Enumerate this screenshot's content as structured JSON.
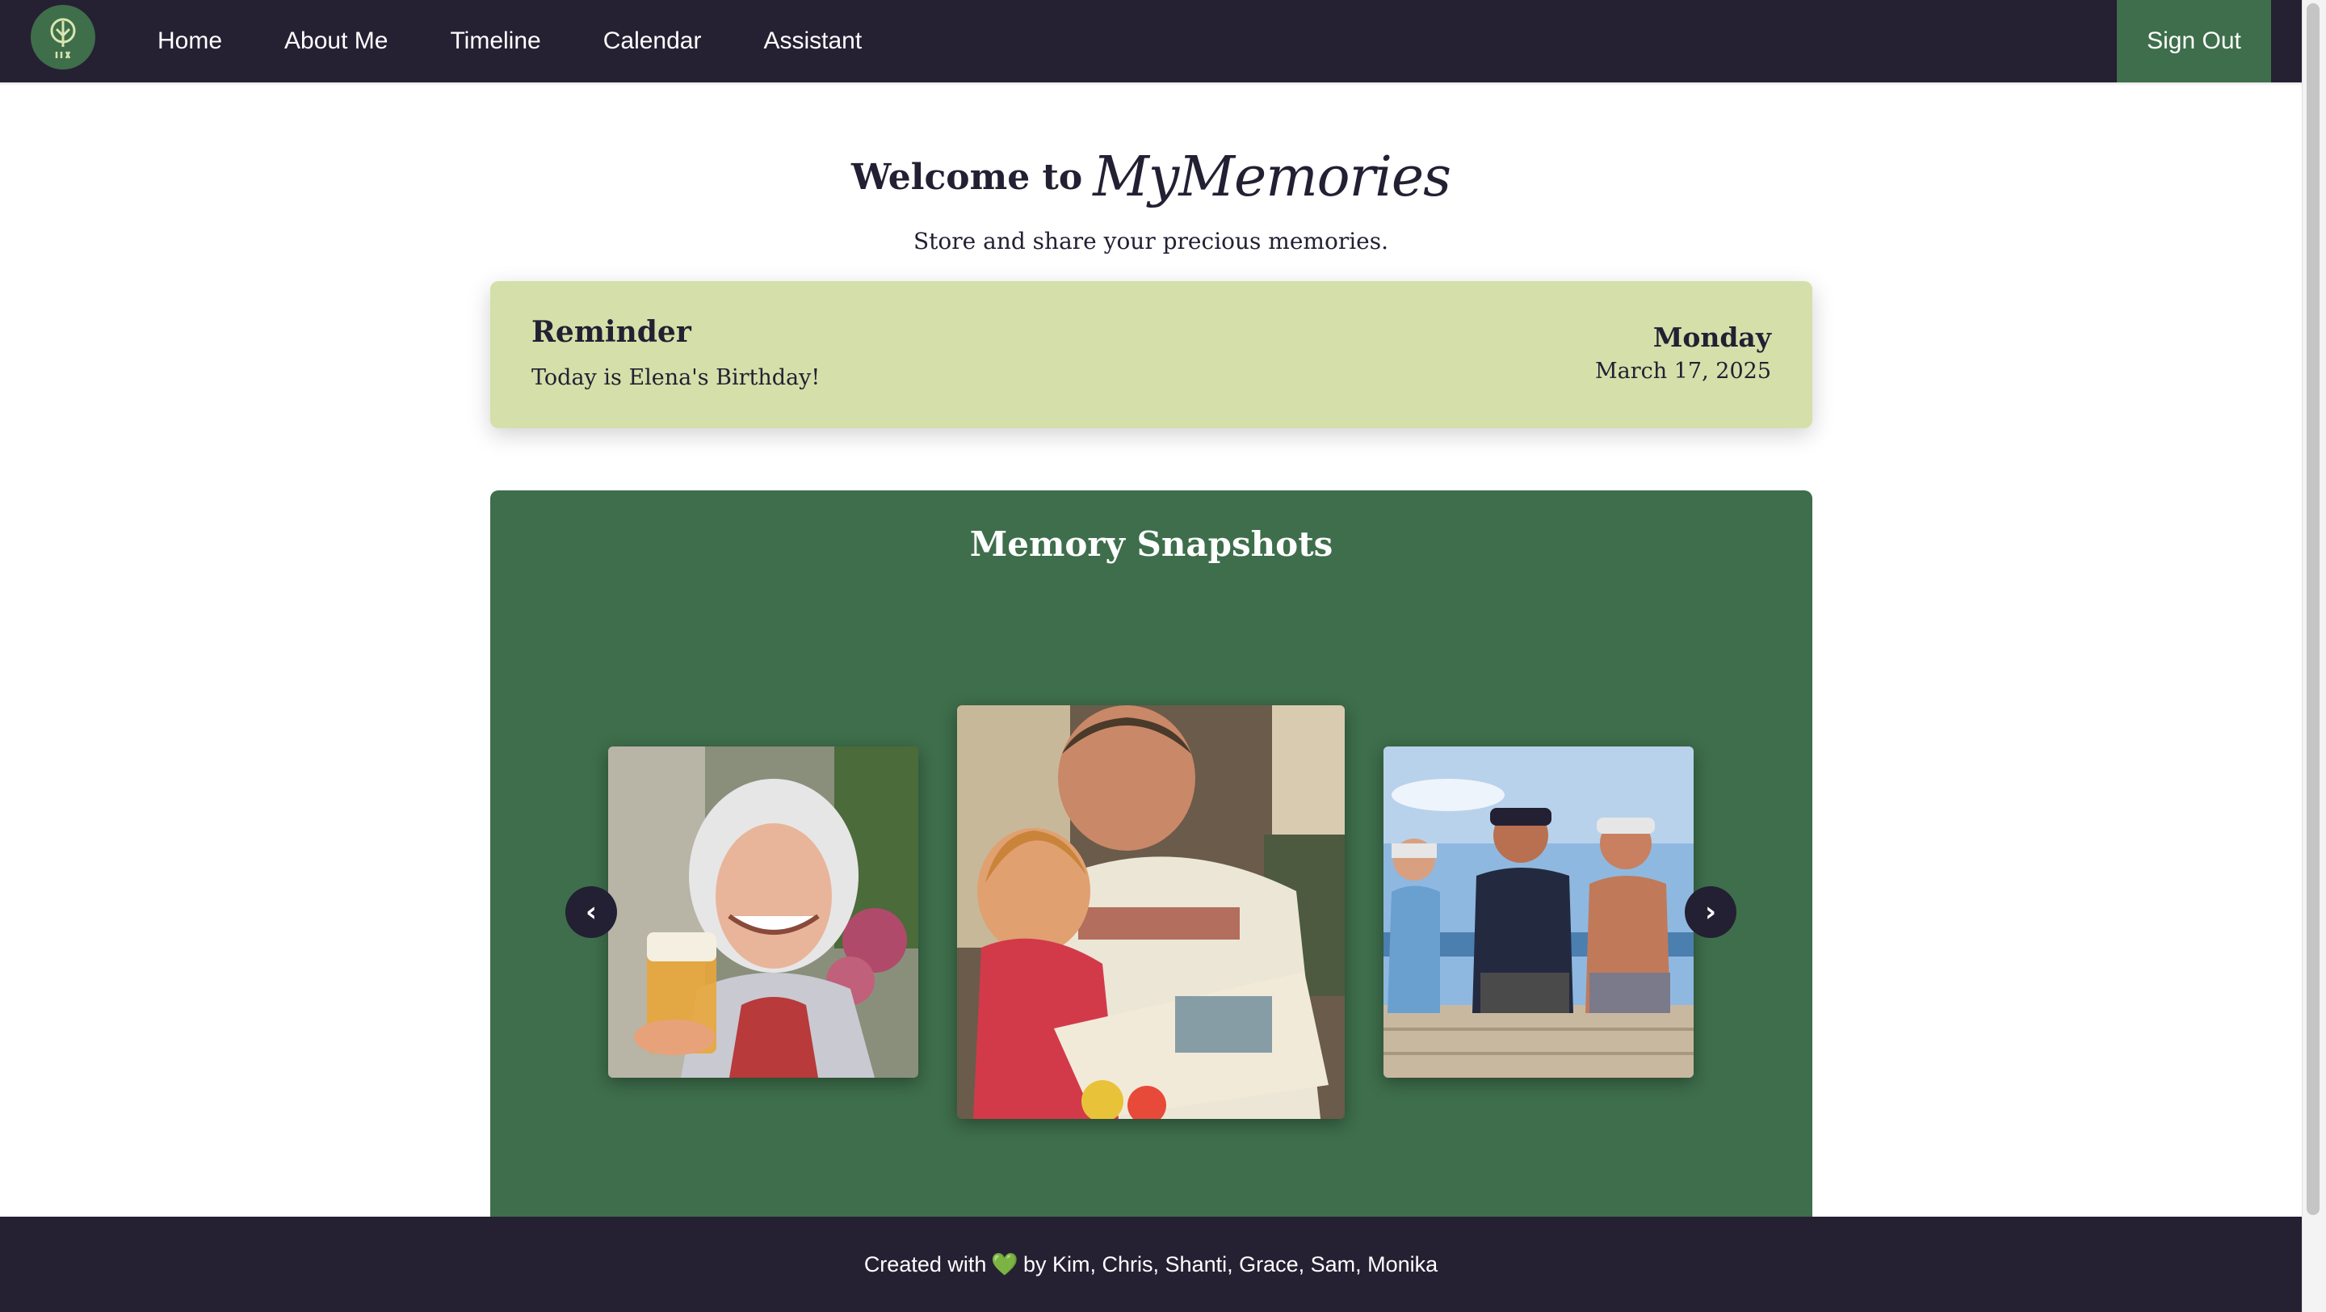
{
  "nav": {
    "logo_icon": "memory-tree-icon",
    "links": [
      "Home",
      "About Me",
      "Timeline",
      "Calendar",
      "Assistant"
    ],
    "sign_out": "Sign Out"
  },
  "hero": {
    "welcome": "Welcome to",
    "brand": "MyMemories",
    "subtitle": "Store and share your precious memories."
  },
  "reminder": {
    "heading": "Reminder",
    "text": "Today is Elena's Birthday!",
    "day": "Monday",
    "date": "March 17, 2025"
  },
  "snapshots": {
    "title": "Memory Snapshots",
    "prev_icon": "‹",
    "next_icon": "›",
    "photos": [
      "photo-elderly-woman-with-beer",
      "photo-man-reading-to-child",
      "photo-three-men-on-dock"
    ]
  },
  "footer": {
    "prefix": "Created with",
    "heart": "💚",
    "suffix": "by Kim, Chris, Shanti, Grace, Sam, Monika"
  },
  "colors": {
    "nav_bg": "#262033",
    "accent_green": "#3e6e4b",
    "reminder_bg": "#d5dfa9",
    "footer_heart": "#3fbf4c"
  }
}
